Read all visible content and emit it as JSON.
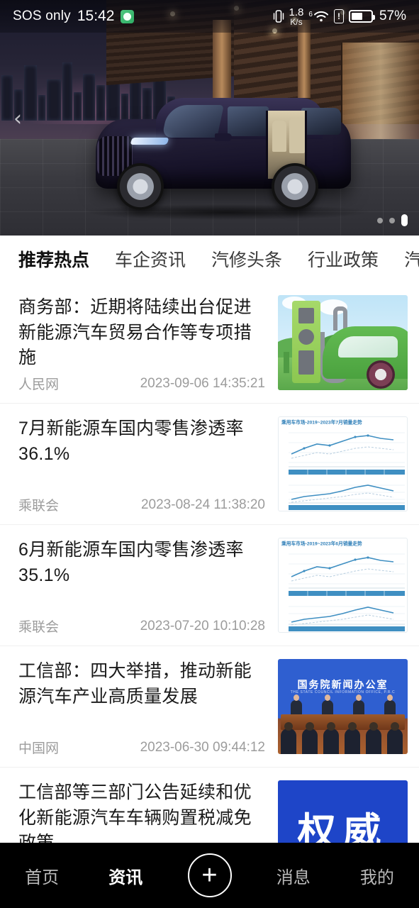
{
  "status_bar": {
    "carrier": "SOS only",
    "clock": "15:42",
    "app_icon": "green-app-icon",
    "vibrate_icon": "vibrate-icon",
    "net_speed_value": "1.8",
    "net_speed_unit": "K/s",
    "wifi_gen": "6",
    "wifi_icon": "wifi-icon",
    "alert_icon": "sim-alert-icon",
    "battery_icon": "battery-icon",
    "battery_percent": "57%",
    "battery_level": 57
  },
  "banner": {
    "prev_arrow": "‹",
    "alt": "luxury-mpv-night-city",
    "slides_total": 3,
    "active_slide": 3
  },
  "tabs": [
    {
      "label": "推荐热点",
      "active": true
    },
    {
      "label": "车企资讯",
      "active": false
    },
    {
      "label": "汽修头条",
      "active": false
    },
    {
      "label": "行业政策",
      "active": false
    },
    {
      "label": "汽车助手",
      "active": false
    }
  ],
  "news": [
    {
      "title": "商务部：近期将陆续出台促进新能源汽车贸易合作等专项措施",
      "source": "人民网",
      "datetime": "2023-09-06 14:35:21",
      "thumb": "ev-charging-illustration"
    },
    {
      "title": "7月新能源车国内零售渗透率36.1%",
      "source": "乘联会",
      "datetime": "2023-08-24 11:38:20",
      "thumb": "sales-trend-chart",
      "thumb_caption": "乘用车市场-2019~2023年7月销量走势"
    },
    {
      "title": "6月新能源车国内零售渗透率35.1%",
      "source": "乘联会",
      "datetime": "2023-07-20 10:10:28",
      "thumb": "sales-trend-chart",
      "thumb_caption": "乘用车市场-2019~2023年6月销量走势"
    },
    {
      "title": "工信部：四大举措，推动新能源汽车产业高质量发展",
      "source": "中国网",
      "datetime": "2023-06-30 09:44:12",
      "thumb": "press-conference-photo",
      "thumb_caption": "国务院新闻办公室",
      "thumb_caption_sub": "THE STATE COUNCIL INFORMATION OFFICE, P.R.C"
    },
    {
      "title": "工信部等三部门公告延续和优化新能源汽车车辆购置税减免政策",
      "source": "",
      "datetime": "",
      "thumb": "authority-blue-banner",
      "thumb_caption": "权威"
    }
  ],
  "bottom_nav": [
    {
      "label": "首页",
      "active": false
    },
    {
      "label": "资讯",
      "active": true
    },
    {
      "label": "+",
      "active": false
    },
    {
      "label": "消息",
      "active": false
    },
    {
      "label": "我的",
      "active": false
    }
  ],
  "colors": {
    "accent_blue": "#1e45c8",
    "chart_blue": "#3f8fc2",
    "nav_bg": "#000000",
    "meta_gray": "#9c9c9c"
  }
}
